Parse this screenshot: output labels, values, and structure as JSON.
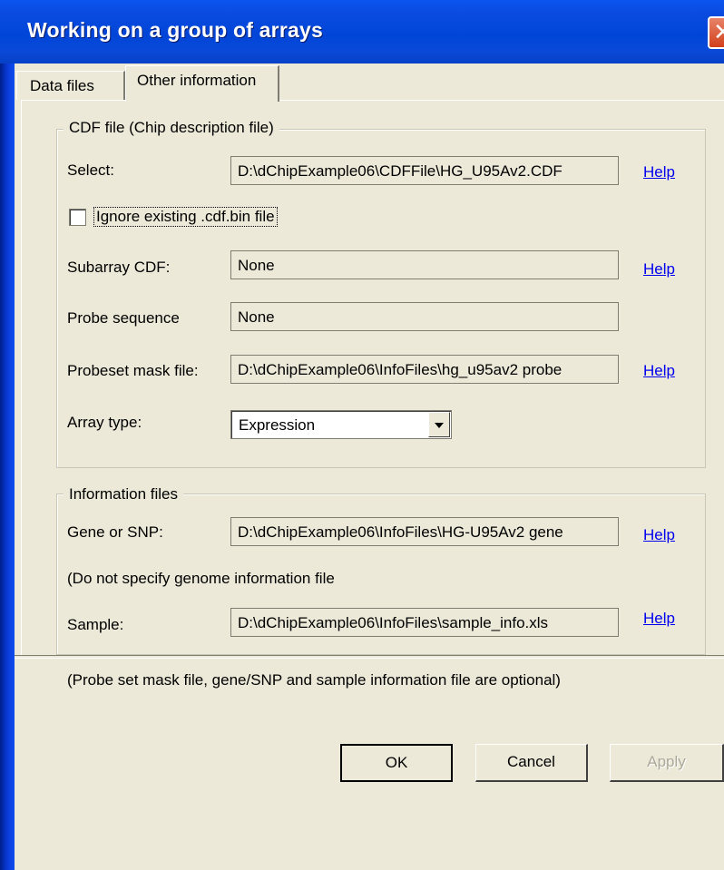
{
  "window": {
    "title": "Working on a group of arrays",
    "close_icon": "close-icon"
  },
  "tabs": [
    {
      "label": "Data files",
      "active": false
    },
    {
      "label": "Other information",
      "active": true
    }
  ],
  "cdf_group": {
    "legend": "CDF file (Chip description file)",
    "select_label": "Select:",
    "select_value": "D:\\dChipExample06\\CDFFile\\HG_U95Av2.CDF",
    "checkbox_label": "Ignore existing .cdf.bin file",
    "checkbox_checked": false,
    "subarray_label": "Subarray CDF:",
    "subarray_value": "None",
    "probe_seq_label": "Probe sequence",
    "probe_seq_value": "None",
    "probeset_mask_label": "Probeset mask file:",
    "probeset_mask_value": "D:\\dChipExample06\\InfoFiles\\hg_u95av2 probe",
    "array_type_label": "Array type:",
    "array_type_value": "Expression"
  },
  "info_group": {
    "legend": "Information files",
    "gene_label": "Gene or SNP:",
    "gene_value": "D:\\dChipExample06\\InfoFiles\\HG-U95Av2 gene",
    "genome_note": "(Do not specify genome information file",
    "sample_label": "Sample:",
    "sample_value": "D:\\dChipExample06\\InfoFiles\\sample_info.xls"
  },
  "help_label": "Help",
  "footnote": "(Probe set mask file, gene/SNP and sample information file are optional)",
  "buttons": {
    "ok": "OK",
    "cancel": "Cancel",
    "apply": "Apply"
  },
  "colors": {
    "title_bar": "#0a4ee0",
    "dialog_bg": "#ece9d8",
    "link": "#0000ee"
  }
}
